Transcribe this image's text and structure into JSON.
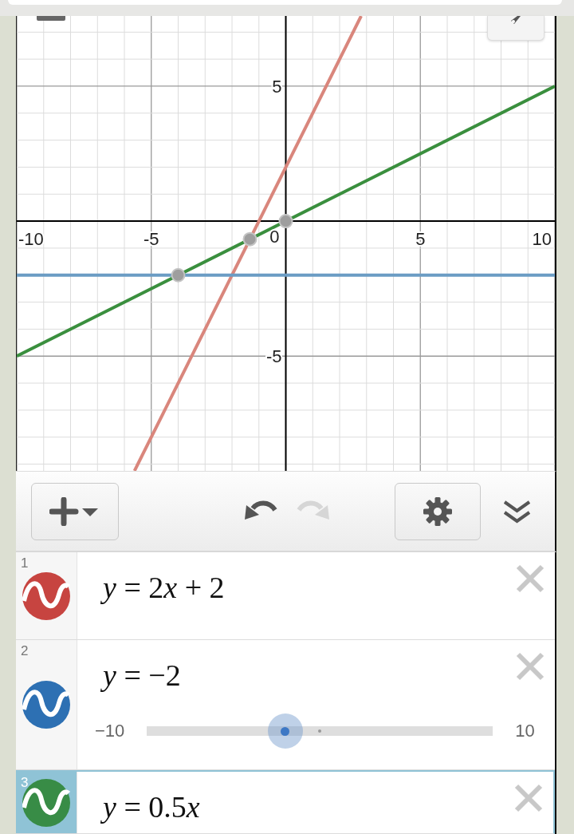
{
  "graph": {
    "chart_data": {
      "type": "line",
      "x": [
        -10,
        -5.625,
        2.8,
        10
      ],
      "xlim": [
        -10,
        10
      ],
      "ylim": [
        -9.25,
        7.6
      ],
      "xticks": [
        -10,
        -5,
        0,
        5,
        10
      ],
      "yticks": [
        -5,
        5
      ],
      "grid": true,
      "series": [
        {
          "color": "#d9867c",
          "values": [
            null,
            -9.25,
            7.6,
            null
          ]
        },
        {
          "color": "#6b9cc4",
          "values": [
            -2,
            -2,
            -2,
            -2
          ]
        },
        {
          "color": "#3a8f3e",
          "values": [
            -5,
            -2.8125,
            1.4,
            5
          ]
        }
      ]
    }
  },
  "toolbar": {
    "undo": {
      "disabled": false
    },
    "redo": {
      "disabled": true
    }
  },
  "expressions": [
    {
      "number": "1",
      "kind": "plain",
      "color": "#c74440",
      "latex": "y = 2x + 2",
      "selected": false
    },
    {
      "number": "2",
      "kind": "slider",
      "color": "#2d70b3",
      "latex": "y = −2",
      "selected": false,
      "slider": {
        "min": "−10",
        "max": "10",
        "level": 0.4
      }
    },
    {
      "number": "3",
      "kind": "plain",
      "color": "#388c46",
      "latex": "y = 0.5x",
      "selected": true
    }
  ]
}
